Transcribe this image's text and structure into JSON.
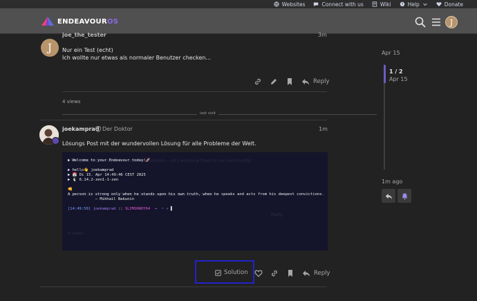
{
  "topnav": {
    "items": [
      {
        "icon": "globe-icon",
        "label": "Websites"
      },
      {
        "icon": "chat-icon",
        "label": "Connect with us"
      },
      {
        "icon": "book-icon",
        "label": "Wiki"
      },
      {
        "icon": "help-icon",
        "label": "Help"
      },
      {
        "icon": "heart-icon",
        "label": "Donate"
      }
    ]
  },
  "header": {
    "logo_main": "ENDEAVOUR",
    "logo_os": "OS",
    "user_initial": "J"
  },
  "post1": {
    "username": "joe_the_tester",
    "time": "3m",
    "avatar_initial": "J",
    "line1": "Nur ein Test (echt)",
    "line2": "Ich wollte nur etwas als normaler Benutzer checken...",
    "reply_label": "Reply",
    "views": "4 views"
  },
  "last_visit_label": "last visit",
  "post2": {
    "username": "joekamprad",
    "title": "Der Doktor",
    "time": "1m",
    "body": "Lösungs Post mit der wundervollen Lösung für alle Probleme der Welt.",
    "solution_label": "Solution",
    "reply_label": "Reply"
  },
  "terminal": {
    "ghost_top": "This is the first time joe_the_tester has posted — let's welcome them to our community!",
    "ghost_mid": "Nur ein Test (echt) ich wollte nur etwas als normaler Benutzer checken...",
    "ghost_reply": "Reply",
    "ghost_views": "4 views",
    "line1": "▶ Welcome to your Endeavour today!🚀",
    "line2": "▶ hello👋 joekamprad",
    "line3": "▶ 📅 Di 15. Apr 14:49:46 CEST 2025",
    "line4": "▶ 🐧 6.14.2-zen1-1-zen",
    "line5": "👊",
    "line6": "A person is strong only when he stands upon his own truth, when he speaks and acts from his deepest convictions.",
    "line7": "            — Mikhail Bakunin",
    "prompt_time": "[14:49:50]",
    "prompt_user": "joekamprad",
    "prompt_sep": "::",
    "prompt_host": "SLIMSHADY64",
    "prompt_rest": "➜  ~ »"
  },
  "timeline": {
    "top_date": "Apr 15",
    "counter": "1 / 2",
    "counter_date": "Apr 15",
    "bottom_label": "1m ago"
  },
  "colors": {
    "accent": "#6e5bc7",
    "highlight_box": "#2222cc",
    "background": "#222222",
    "header": "#505050"
  }
}
